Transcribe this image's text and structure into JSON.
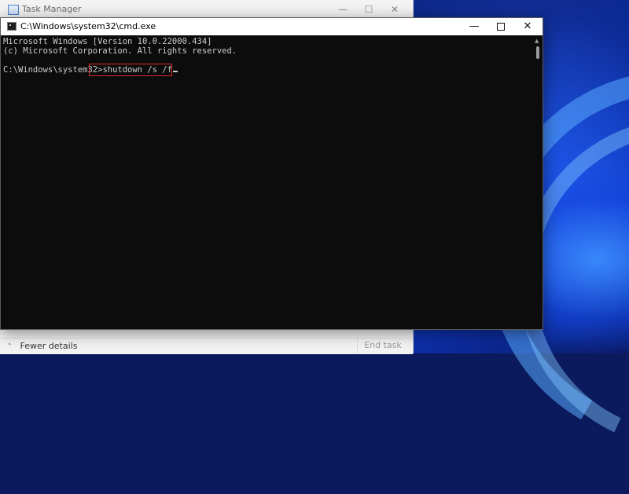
{
  "taskmgr": {
    "title": "Task Manager",
    "min_glyph": "—",
    "max_glyph": "☐",
    "close_glyph": "✕",
    "fewer_details": "Fewer details",
    "end_task": "End task"
  },
  "cmd": {
    "title": "C:\\Windows\\system32\\cmd.exe",
    "min_glyph": "—",
    "close_glyph": "✕",
    "lines": [
      "Microsoft Windows [Version 10.0.22000.434]",
      "(c) Microsoft Corporation. All rights reserved."
    ],
    "prompt": "C:\\Windows\\system32>",
    "command": "shutdown /s /f",
    "highlight_color": "#d42a2a"
  },
  "icons": {
    "taskmgr": "task-manager-icon",
    "cmd": "console-icon",
    "chevron": "chevron-up-icon"
  }
}
